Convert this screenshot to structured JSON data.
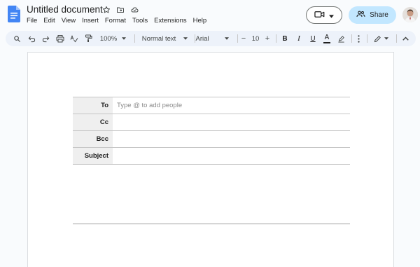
{
  "document": {
    "title": "Untitled document"
  },
  "menu": [
    "File",
    "Edit",
    "View",
    "Insert",
    "Format",
    "Tools",
    "Extensions",
    "Help"
  ],
  "header": {
    "share_label": "Share"
  },
  "toolbar": {
    "zoom": "100%",
    "style": "Normal text",
    "font": "Arial",
    "font_size": "10",
    "minus": "−",
    "plus": "+",
    "bold": "B",
    "italic": "I",
    "underline": "U",
    "text_color": "A"
  },
  "email_draft": {
    "to_label": "To",
    "to_placeholder": "Type @ to add people",
    "cc_label": "Cc",
    "bcc_label": "Bcc",
    "subject_label": "Subject"
  },
  "colors": {
    "docs_blue": "#4285f4",
    "share_bg": "#c2e7ff",
    "toolbar_bg": "#edf2fa"
  }
}
